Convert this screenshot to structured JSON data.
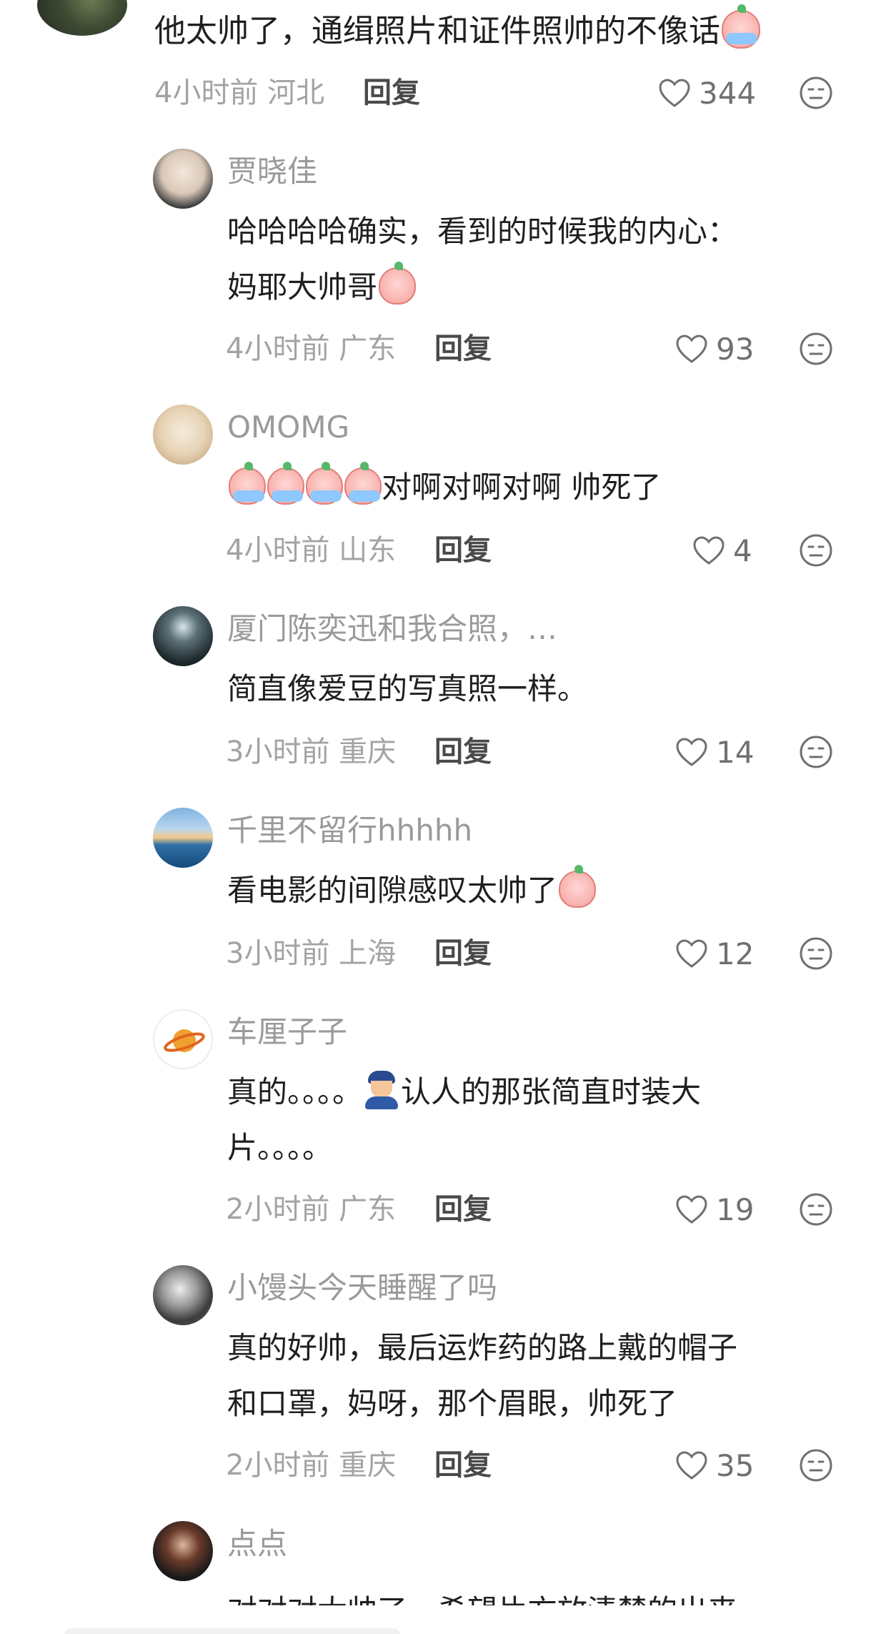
{
  "top_comment": {
    "text": "他太帅了，通缉照片和证件照帅的不像话",
    "time": "4小时前 河北",
    "reply_label": "回复",
    "likes": "344"
  },
  "comments": [
    {
      "name": "贾晓佳",
      "line1": "哈哈哈哈确实，看到的时候我的内心：",
      "line2": "妈耶大帅哥",
      "time": "4小时前 广东",
      "reply_label": "回复",
      "likes": "93"
    },
    {
      "name": "OMOMG",
      "line1": "对啊对啊对啊 帅死了",
      "time": "4小时前 山东",
      "reply_label": "回复",
      "likes": "4"
    },
    {
      "name": "厦门陈奕迅和我合照，…",
      "line1": "简直像爱豆的写真照一样。",
      "time": "3小时前 重庆",
      "reply_label": "回复",
      "likes": "14"
    },
    {
      "name": "千里不留行hhhhh",
      "line1": "看电影的间隙感叹太帅了",
      "time": "3小时前 上海",
      "reply_label": "回复",
      "likes": "12"
    },
    {
      "name": "车厘子子",
      "line1a": "真的。。。。",
      "line1b": "认人的那张简直时装大",
      "line2": "片。。。。",
      "time": "2小时前 广东",
      "reply_label": "回复",
      "likes": "19"
    },
    {
      "name": "小馒头今天睡醒了吗",
      "line1": "真的好帅，最后运炸药的路上戴的帽子",
      "line2": "和口罩，妈呀，那个眉眼，帅死了",
      "time": "2小时前 重庆",
      "reply_label": "回复",
      "likes": "35"
    },
    {
      "name": "点点",
      "line1": "对对对太帅了，希望片方放清楚的出来"
    }
  ],
  "icons": {
    "like": "heart-outline-icon",
    "more": "emoji-face-icon"
  },
  "colors": {
    "name": "#9a9a9a",
    "text": "#1f1f1f",
    "meta": "#a3a3a3",
    "reply": "#4a4a4a"
  }
}
